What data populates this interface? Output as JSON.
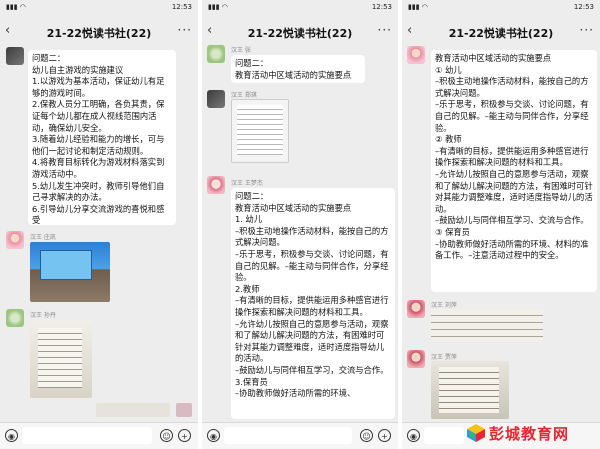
{
  "status_time": "12:53",
  "chat_title": "21-22悦读书社(22)",
  "panel1": {
    "msg1": "问题二：\n幼儿自主游戏的实施建议\n1.以游戏为基本活动，保证幼儿有足够的游戏时间。\n2.保教人员分工明确，各负其责，保证每个幼儿都在成人视线范围内活动，确保幼儿安全。\n3.随着幼儿经验和能力的增长，可与他们一起讨论和制定活动规则。\n4.将教育目标转化为游戏材料落实到游戏活动中。\n5.幼儿发生冲突时，教师引导他们自己寻求解决的办法。\n6.引导幼儿分享交流游戏的喜悦和感受",
    "sender2": "汉王 庄凯",
    "sender3": "汉王 孙丹"
  },
  "panel2": {
    "sender1": "汉王 张",
    "msg1": "问题二：\n教育活动中区域活动的实施要点",
    "sender2": "汉王 郑琪",
    "sender3": "汉王 王梦杰",
    "msg3": "问题二：\n教育活动中区域活动的实施要点\n1. 幼儿\n–积极主动地操作活动材料，能按自己的方式解决问题。\n–乐于思考，积极参与交谈、讨论问题，有自己的见解。–能主动与同伴合作，分享经验。\n2.教师\n–有清晰的目标，提供能运用多种感官进行操作探索和解决问题的材料和工具。\n–允许幼儿按照自己的意愿参与活动，观察和了解幼儿解决问题的方法，有困难时可针对其能力调整难度，适时适度指导幼儿的活动。\n–鼓励幼儿与同伴相互学习，交流与合作。\n3.保育员\n–协助教师做好活动所需的环境、"
  },
  "panel3": {
    "msg1": "教育活动中区域活动的实施要点\n① 幼儿\n–积极主动地操作活动材料，能按自己的方式解决问题。\n–乐于思考，积极参与交谈、讨论问题，有自己的见解。–能主动与同伴合作，分享经验。\n② 教师\n–有清晰的目标，提供能运用多种感官进行操作探索和解决问题的材料和工具。\n–允许幼儿按照自己的意愿参与活动，观察和了解幼儿解决问题的方法，有困难时可针对其能力调整难度，适时适度指导幼儿的活动。\n–鼓励幼儿与同伴相互学习、交流与合作。\n③ 保育员\n–协助教师做好活动所需的环境、材料的准备工作。–注意活动过程中的安全。",
    "sender2": "汉王 刘萍",
    "sender3": "汉王 贾萍"
  },
  "watermark": "彭城教育网"
}
